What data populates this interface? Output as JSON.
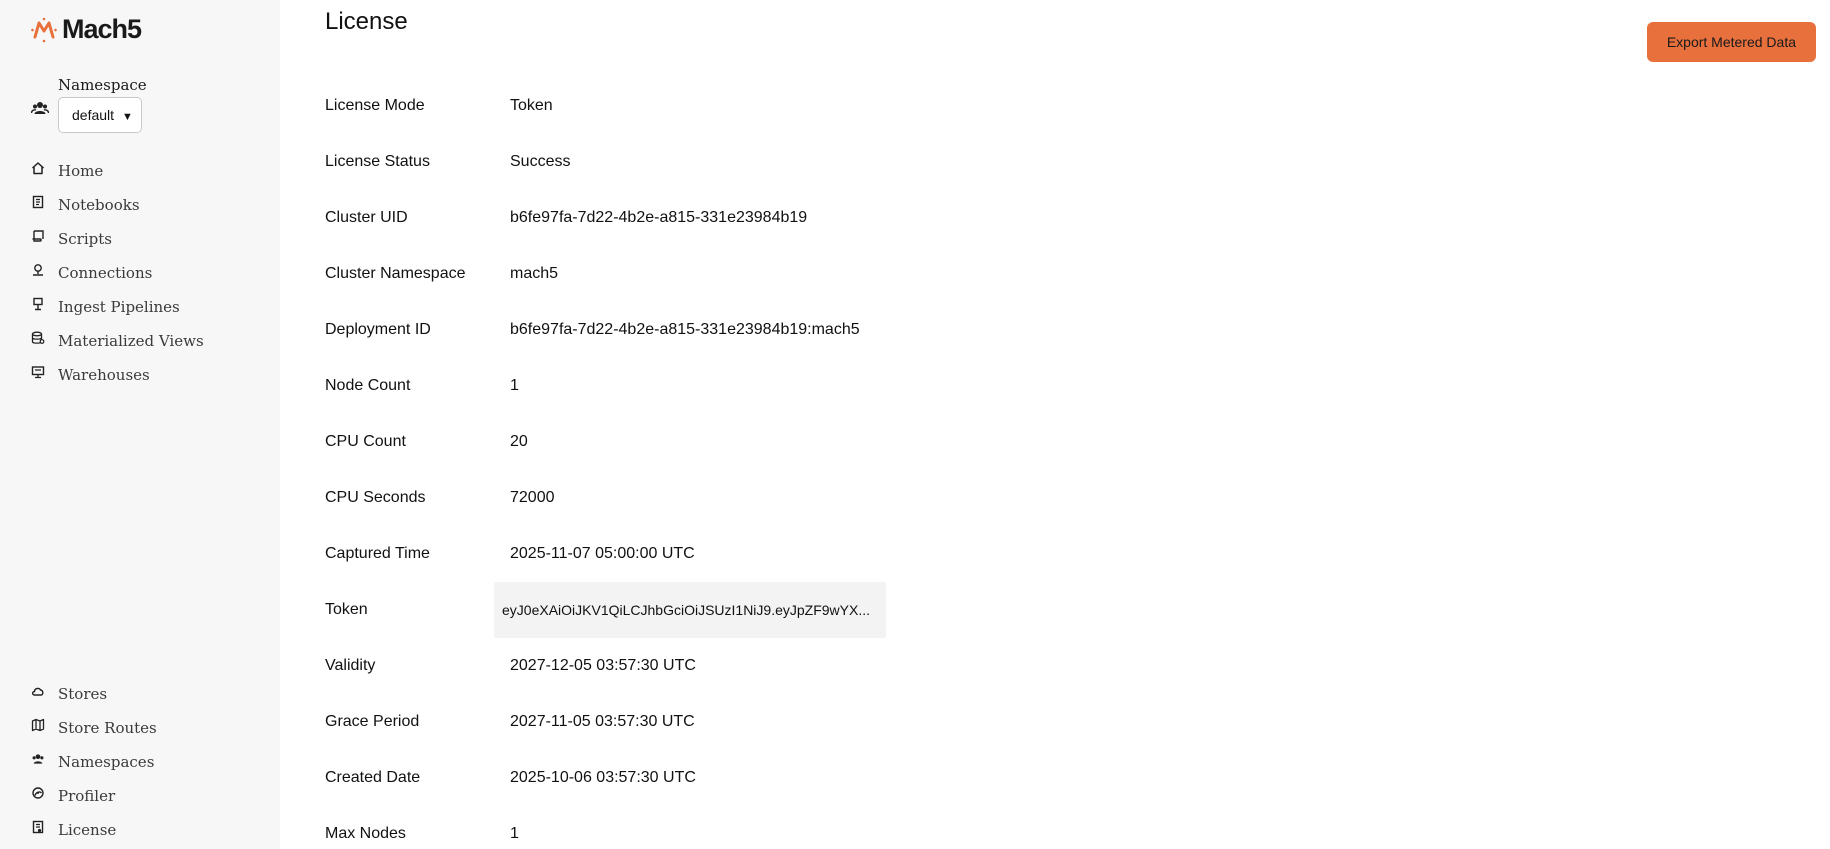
{
  "brand": {
    "name": "Mach5",
    "accent": "#e8703d"
  },
  "namespace": {
    "label": "Namespace",
    "selected": "default",
    "icon": "users-icon"
  },
  "sidebar": {
    "top_items": [
      {
        "label": "Home",
        "icon": "home-icon"
      },
      {
        "label": "Notebooks",
        "icon": "notebook-icon"
      },
      {
        "label": "Scripts",
        "icon": "script-icon"
      },
      {
        "label": "Connections",
        "icon": "connection-icon"
      },
      {
        "label": "Ingest Pipelines",
        "icon": "pipeline-icon"
      },
      {
        "label": "Materialized Views",
        "icon": "database-icon"
      },
      {
        "label": "Warehouses",
        "icon": "warehouse-icon"
      }
    ],
    "bottom_items": [
      {
        "label": "Stores",
        "icon": "cloud-icon"
      },
      {
        "label": "Store Routes",
        "icon": "map-icon"
      },
      {
        "label": "Namespaces",
        "icon": "users-icon"
      },
      {
        "label": "Profiler",
        "icon": "profiler-icon"
      },
      {
        "label": "License",
        "icon": "license-icon"
      }
    ]
  },
  "main": {
    "title": "License",
    "export_button": "Export Metered Data",
    "fields": [
      {
        "key": "License Mode",
        "value": "Token"
      },
      {
        "key": "License Status",
        "value": "Success"
      },
      {
        "key": "Cluster UID",
        "value": "b6fe97fa-7d22-4b2e-a815-331e23984b19"
      },
      {
        "key": "Cluster Namespace",
        "value": "mach5"
      },
      {
        "key": "Deployment ID",
        "value": "b6fe97fa-7d22-4b2e-a815-331e23984b19:mach5"
      },
      {
        "key": "Node Count",
        "value": "1"
      },
      {
        "key": "CPU Count",
        "value": "20"
      },
      {
        "key": "CPU Seconds",
        "value": "72000"
      },
      {
        "key": "Captured Time",
        "value": "2025-11-07 05:00:00 UTC"
      },
      {
        "key": "Token",
        "value": "eyJ0eXAiOiJKV1QiLCJhbGciOiJSUzI1NiJ9.eyJpZF9wYX..."
      },
      {
        "key": "Validity",
        "value": "2027-12-05 03:57:30 UTC"
      },
      {
        "key": "Grace Period",
        "value": "2027-11-05 03:57:30 UTC"
      },
      {
        "key": "Created Date",
        "value": "2025-10-06 03:57:30 UTC"
      },
      {
        "key": "Max Nodes",
        "value": "1"
      }
    ]
  }
}
